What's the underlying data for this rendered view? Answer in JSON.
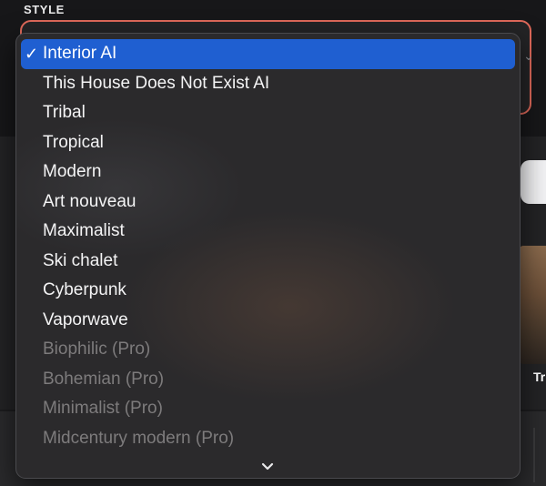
{
  "section_label": "STYLE",
  "menu": {
    "selected_index": 0,
    "items": [
      {
        "label": "Interior AI",
        "selected": true,
        "enabled": true
      },
      {
        "label": "This House Does Not Exist AI",
        "selected": false,
        "enabled": true
      },
      {
        "label": "Tribal",
        "selected": false,
        "enabled": true
      },
      {
        "label": "Tropical",
        "selected": false,
        "enabled": true
      },
      {
        "label": "Modern",
        "selected": false,
        "enabled": true
      },
      {
        "label": "Art nouveau",
        "selected": false,
        "enabled": true
      },
      {
        "label": "Maximalist",
        "selected": false,
        "enabled": true
      },
      {
        "label": "Ski chalet",
        "selected": false,
        "enabled": true
      },
      {
        "label": "Cyberpunk",
        "selected": false,
        "enabled": true
      },
      {
        "label": "Vaporwave",
        "selected": false,
        "enabled": true
      },
      {
        "label": "Biophilic (Pro)",
        "selected": false,
        "enabled": false
      },
      {
        "label": "Bohemian (Pro)",
        "selected": false,
        "enabled": false
      },
      {
        "label": "Minimalist (Pro)",
        "selected": false,
        "enabled": false
      },
      {
        "label": "Midcentury modern (Pro)",
        "selected": false,
        "enabled": false
      }
    ],
    "check_glyph": "✓",
    "scroll_icon": "chevron-down-icon"
  },
  "background": {
    "thumbnail_caption": "Tr"
  },
  "colors": {
    "selection": "#1f5fd1",
    "focus_ring": "#e0695a",
    "menu_text": "#f4f4f5",
    "disabled_text": "#7d7b7c"
  }
}
